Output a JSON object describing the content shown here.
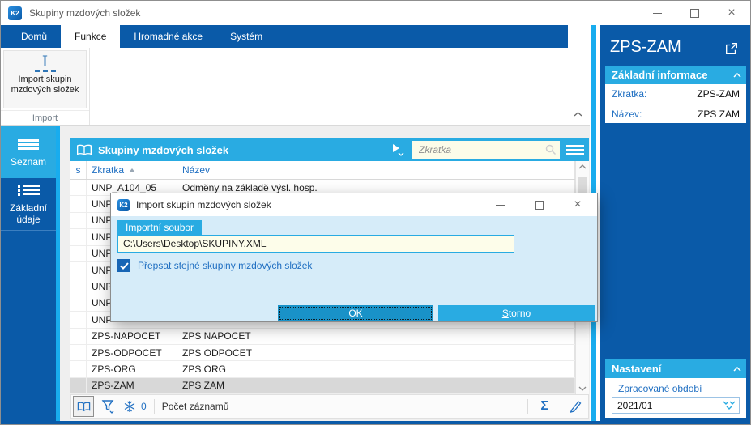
{
  "window": {
    "title": "Skupiny mzdových složek"
  },
  "icons": {
    "k2_logo": "K2",
    "close": "×",
    "sum": "Σ"
  },
  "ribbon": {
    "tabs": [
      {
        "label": "Domů",
        "active": false
      },
      {
        "label": "Funkce",
        "active": true
      },
      {
        "label": "Hromadné akce",
        "active": false
      },
      {
        "label": "Systém",
        "active": false
      }
    ],
    "import_button": {
      "line1": "Import skupin",
      "line2": "mzdových složek"
    },
    "group_label": "Import"
  },
  "sidebar": {
    "items": [
      {
        "label": "Seznam",
        "active": true
      },
      {
        "label_line1": "Základní",
        "label_line2": "údaje",
        "active": false
      }
    ]
  },
  "browse": {
    "title": "Skupiny mzdových složek",
    "search_placeholder": "Zkratka",
    "columns": {
      "state": "s",
      "code": "Zkratka",
      "name": "Název"
    },
    "rows": [
      {
        "s": "",
        "code": "UNP_A104_05",
        "name": "Odměny na základě výsl. hosp.",
        "selected": false
      },
      {
        "s": "",
        "code": "UNP",
        "name": "",
        "selected": false
      },
      {
        "s": "",
        "code": "UNP",
        "name": "",
        "selected": false
      },
      {
        "s": "",
        "code": "UNP",
        "name": "",
        "selected": false
      },
      {
        "s": "",
        "code": "UNP",
        "name": "",
        "selected": false
      },
      {
        "s": "",
        "code": "UNP",
        "name": "",
        "selected": false
      },
      {
        "s": "",
        "code": "UNP",
        "name": "",
        "selected": false
      },
      {
        "s": "",
        "code": "UNP",
        "name": "",
        "selected": false
      },
      {
        "s": "",
        "code": "UNP",
        "name": "",
        "selected": false
      },
      {
        "s": "",
        "code": "ZPS-NAPOCET",
        "name": "ZPS NAPOCET",
        "selected": false
      },
      {
        "s": "",
        "code": "ZPS-ODPOCET",
        "name": "ZPS ODPOCET",
        "selected": false
      },
      {
        "s": "",
        "code": "ZPS-ORG",
        "name": "ZPS ORG",
        "selected": false
      },
      {
        "s": "",
        "code": "ZPS-ZAM",
        "name": "ZPS ZAM",
        "selected": true
      }
    ],
    "status": {
      "frozen_count": "0",
      "records_label": "Počet záznamů"
    }
  },
  "dialog": {
    "title": "Import skupin mzdových složek",
    "file_label": "Importní soubor",
    "file_value": "C:\\Users\\Desktop\\SKUPINY.XML",
    "checkbox": {
      "label": "Přepsat stejné skupiny mzdových složek",
      "checked": true
    },
    "buttons": {
      "ok": "OK",
      "cancel": "Storno",
      "cancel_underline": "S",
      "cancel_rest": "torno"
    }
  },
  "right_panel": {
    "title": "ZPS-ZAM",
    "basic_info": {
      "title": "Základní informace",
      "fields": [
        {
          "label": "Zkratka:",
          "value": "ZPS-ZAM"
        },
        {
          "label": "Název:",
          "value": "ZPS ZAM"
        }
      ]
    },
    "settings": {
      "title": "Nastavení",
      "period_label": "Zpracované období",
      "period_value": "2021/01"
    }
  },
  "colors": {
    "dark_blue": "#0a5aa8",
    "cyan_accent": "#29abe2",
    "strip_cyan": "#18acee",
    "ok_button": "#1992c8",
    "dialog_bg": "#d6ecf9",
    "input_yellow": "#fcfce9",
    "selected_row": "#d8d8d8",
    "label_blue": "#2170c2"
  }
}
